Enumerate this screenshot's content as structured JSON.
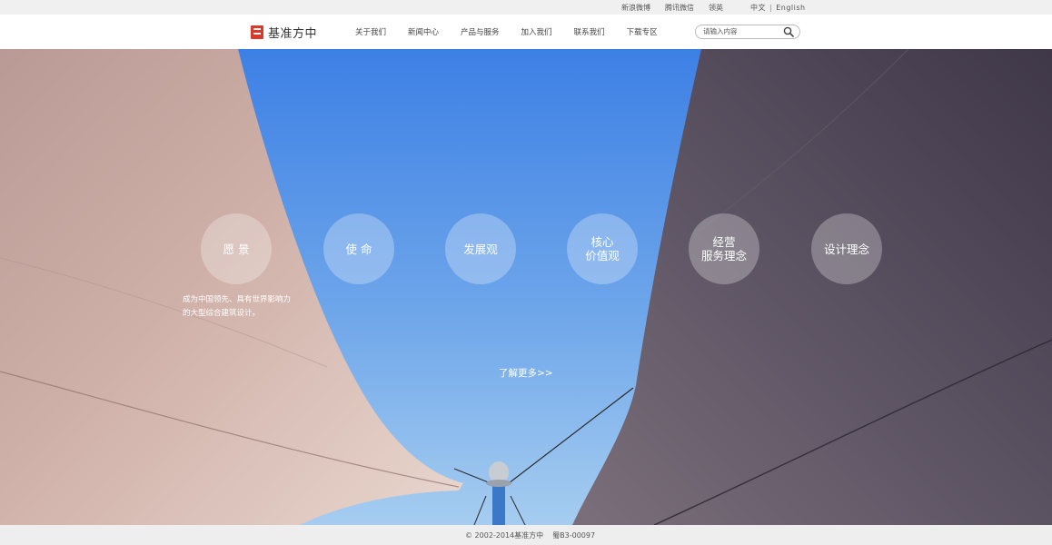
{
  "topbar": {
    "links": [
      "新浪微博",
      "腾讯微信",
      "领英"
    ],
    "lang_cn": "中文",
    "lang_sep": "|",
    "lang_en": "English"
  },
  "header": {
    "logo_text": "基准方中",
    "nav": [
      "关于我们",
      "新闻中心",
      "产品与服务",
      "加入我们",
      "联系我们",
      "下载专区"
    ],
    "search_placeholder": "请输入内容"
  },
  "hero": {
    "circles": [
      {
        "line1": "愿 景",
        "line2": ""
      },
      {
        "line1": "使 命",
        "line2": ""
      },
      {
        "line1": "发展观",
        "line2": ""
      },
      {
        "line1": "核心",
        "line2": "价值观"
      },
      {
        "line1": "经营",
        "line2": "服务理念"
      },
      {
        "line1": "设计理念",
        "line2": ""
      }
    ],
    "vision_text": "成为中国领先、具有世界影响力的大型综合建筑设计。",
    "more_link": "了解更多>>"
  },
  "footer": {
    "copyright": "© 2002-2014基准方中",
    "icp": "蜀B3-00097"
  },
  "colors": {
    "sky_top": "#3f83e6",
    "sky_bottom": "#9cc7ef",
    "sail_left": "#c7a7a0",
    "sail_right": "#59505f",
    "logo_red": "#d93a2b"
  }
}
